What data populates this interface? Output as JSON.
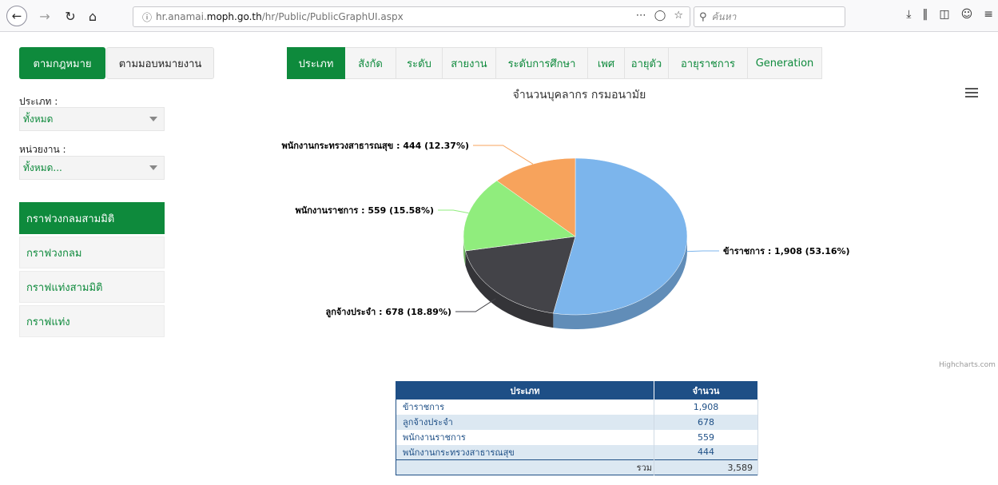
{
  "browser": {
    "url_prefix": "hr.anamai.",
    "url_domain": "moph.go.th",
    "url_path": "/hr/Public/PublicGraphUI.aspx",
    "search_placeholder": "ค้นหา"
  },
  "left": {
    "mode_active": "ตามกฎหมาย",
    "mode_inactive": "ตามมอบหมายงาน",
    "type_label": "ประเภท :",
    "type_value": "ทั้งหมด",
    "unit_label": "หน่วยงาน :",
    "unit_value": "ทั้งหมด...",
    "graph_menu": [
      "กราฟวงกลมสามมิติ",
      "กราฟวงกลม",
      "กราฟแท่งสามมิติ",
      "กราฟแท่ง"
    ]
  },
  "tabs": [
    "ประเภท",
    "สังกัด",
    "ระดับ",
    "สายงาน",
    "ระดับการศึกษา",
    "เพศ",
    "อายุตัว",
    "อายุราชการ",
    "Generation"
  ],
  "chart_data": {
    "type": "pie",
    "title": "จำนวนบุคลากร กรมอนามัย",
    "slices": [
      {
        "name": "ข้าราชการ",
        "value": 1908,
        "percent": 53.16,
        "color": "#7cb5ec",
        "label": "ข้าราชการ : 1,908 (53.16%)"
      },
      {
        "name": "ลูกจ้างประจำ",
        "value": 678,
        "percent": 18.89,
        "color": "#434348",
        "label": "ลูกจ้างประจำ : 678 (18.89%)"
      },
      {
        "name": "พนักงานราชการ",
        "value": 559,
        "percent": 15.58,
        "color": "#90ed7d",
        "label": "พนักงานราชการ : 559 (15.58%)"
      },
      {
        "name": "พนักงานกระทรวงสาธารณสุข",
        "value": 444,
        "percent": 12.37,
        "color": "#f7a35c",
        "label": "พนักงานกระทรวงสาธารณสุข : 444 (12.37%)"
      }
    ],
    "credits": "Highcharts.com"
  },
  "table": {
    "header_type": "ประเภท",
    "header_count": "จำนวน",
    "rows": [
      {
        "type": "ข้าราชการ",
        "count": "1,908"
      },
      {
        "type": "ลูกจ้างประจำ",
        "count": "678"
      },
      {
        "type": "พนักงานราชการ",
        "count": "559"
      },
      {
        "type": "พนักงานกระทรวงสาธารณสุข",
        "count": "444"
      }
    ],
    "total_label": "รวม",
    "total_value": "3,589"
  }
}
